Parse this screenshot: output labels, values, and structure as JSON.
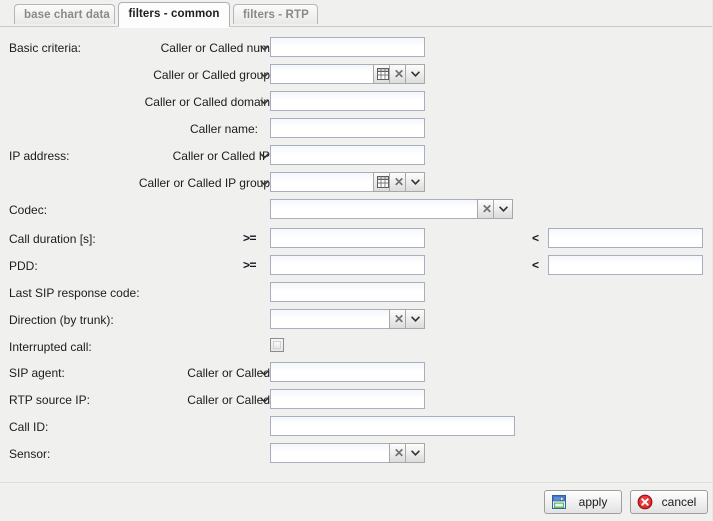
{
  "tabs": [
    {
      "label": "base chart data",
      "active": false
    },
    {
      "label": "filters - common",
      "active": true
    },
    {
      "label": "filters - RTP",
      "active": false
    }
  ],
  "sections": {
    "basic_criteria": "Basic criteria:",
    "ip_address": "IP address:"
  },
  "rows": {
    "caller_or_called_num": {
      "label": "Caller or Called num",
      "selector_icon": "chevron-down-icon",
      "value": "",
      "placeholder": ""
    },
    "caller_or_called_group": {
      "label": "Caller or Called group",
      "selector_icon": "chevron-down-icon",
      "value": "",
      "placeholder": "",
      "buttons": [
        "grid-icon",
        "clear-icon",
        "chevron-down-icon"
      ]
    },
    "caller_or_called_domain": {
      "label": "Caller or Called domain",
      "selector_icon": "chevron-down-icon",
      "value": "",
      "placeholder": ""
    },
    "caller_name": {
      "label": "Caller name:",
      "value": "",
      "placeholder": ""
    },
    "caller_or_called_ip": {
      "label": "Caller or Called IP",
      "selector_icon": "chevron-down-icon",
      "value": "",
      "placeholder": ""
    },
    "caller_or_called_ip_group": {
      "label": "Caller or Called IP group",
      "selector_icon": "chevron-down-icon",
      "value": "",
      "placeholder": "",
      "buttons": [
        "grid-icon",
        "clear-icon",
        "chevron-down-icon"
      ]
    },
    "codec": {
      "label": "Codec:",
      "value": "",
      "placeholder": "",
      "buttons": [
        "clear-icon",
        "chevron-down-icon"
      ]
    },
    "call_duration": {
      "label": "Call duration [s]:",
      "op_min": ">=",
      "value_min": "",
      "op_max": "<",
      "value_max": ""
    },
    "pdd": {
      "label": "PDD:",
      "op_min": ">=",
      "value_min": "",
      "op_max": "<",
      "value_max": ""
    },
    "last_sip_response_code": {
      "label": "Last SIP response code:",
      "value": "",
      "placeholder": ""
    },
    "direction_by_trunk": {
      "label": "Direction (by trunk):",
      "value": "",
      "placeholder": "",
      "buttons": [
        "clear-icon",
        "chevron-down-icon"
      ]
    },
    "interrupted_call": {
      "label": "Interrupted call:",
      "checked": false
    },
    "sip_agent": {
      "label": "SIP agent:",
      "selector_label": "Caller or Called",
      "selector_icon": "chevron-down-icon",
      "value": "",
      "placeholder": ""
    },
    "rtp_source_ip": {
      "label": "RTP source IP:",
      "selector_label": "Caller or Called",
      "selector_icon": "chevron-down-icon",
      "value": "",
      "placeholder": ""
    },
    "call_id": {
      "label": "Call ID:",
      "value": "",
      "placeholder": ""
    },
    "sensor": {
      "label": "Sensor:",
      "value": "",
      "placeholder": "",
      "buttons": [
        "clear-icon",
        "chevron-down-icon"
      ]
    }
  },
  "footer": {
    "apply_label": "apply",
    "apply_icon": "save-floppy-icon",
    "cancel_label": "cancel",
    "cancel_icon": "cancel-circle-icon"
  },
  "colors": {
    "background": "#f0f0ef",
    "field_border": "#a9aebf",
    "tab_active_bg": "#fdfdfd",
    "tab_inactive_text": "#8a8a85",
    "apply_icon_blue": "#3b6fbf",
    "cancel_icon_red": "#d6262a"
  }
}
